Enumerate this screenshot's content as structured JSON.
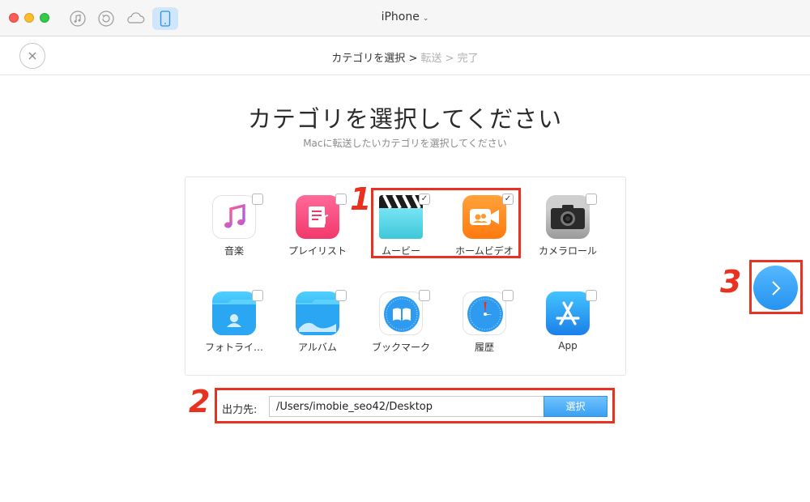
{
  "window": {
    "title": "iPhone"
  },
  "toolbar": {
    "buttons": [
      "music-icon",
      "restore-icon",
      "cloud-icon",
      "device-icon"
    ]
  },
  "stepbar": {
    "step1": "カテゴリを選択",
    "sep1": " > ",
    "step2": "転送",
    "sep2": " > ",
    "step3": "完了"
  },
  "header": {
    "title": "カテゴリを選択してください",
    "subtitle": "Macに転送したいカテゴリを選択してください"
  },
  "categories": [
    {
      "label": "音楽",
      "icon": "music-icon",
      "checked": false
    },
    {
      "label": "プレイリスト",
      "icon": "playlist-icon",
      "checked": false
    },
    {
      "label": "ムービー",
      "icon": "clapperboard-icon",
      "checked": true
    },
    {
      "label": "ホームビデオ",
      "icon": "video-camera-icon",
      "checked": true
    },
    {
      "label": "カメラロール",
      "icon": "camera-icon",
      "checked": false
    },
    {
      "label": "フォトライ…",
      "icon": "photo-folder-icon",
      "checked": false
    },
    {
      "label": "アルバム",
      "icon": "album-folder-icon",
      "checked": false
    },
    {
      "label": "ブックマーク",
      "icon": "bookmark-compass-icon",
      "checked": false
    },
    {
      "label": "履歴",
      "icon": "history-compass-icon",
      "checked": false
    },
    {
      "label": "App",
      "icon": "app-store-icon",
      "checked": false
    }
  ],
  "check_mark": "✓",
  "output": {
    "label": "出力先:",
    "path": "/Users/imobie_seo42/Desktop",
    "select_label": "選択"
  },
  "annotations": {
    "one": "1",
    "two": "2",
    "three": "3"
  },
  "colors": {
    "accent": "#3aa0f3",
    "annotation": "#e8321f"
  }
}
